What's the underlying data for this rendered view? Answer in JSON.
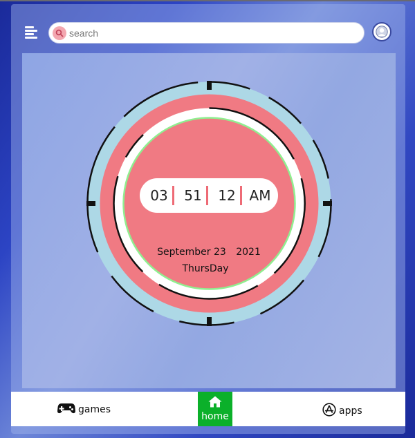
{
  "header": {
    "search_placeholder": "search"
  },
  "clock": {
    "hours": "03",
    "minutes": "51",
    "seconds": "12",
    "meridiem": "AM",
    "month_day": "September 23",
    "year": "2021",
    "weekday": "ThursDay"
  },
  "nav": {
    "games_label": "games",
    "home_label": "home",
    "apps_label": "apps"
  },
  "icons": {
    "menu": "menu-icon",
    "search": "search-icon",
    "avatar": "user-avatar-icon",
    "games": "gamepad-icon",
    "home": "home-icon",
    "apps": "app-store-icon"
  },
  "colors": {
    "clock_face": "#f07a83",
    "outer_ring": "#add8e6",
    "home_active": "#0bb02a",
    "seconds_ring": "#90ee90"
  }
}
